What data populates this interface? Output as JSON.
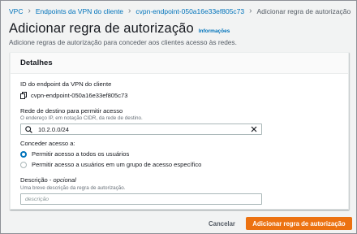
{
  "breadcrumb": {
    "items": [
      "VPC",
      "Endpoints da VPN do cliente",
      "cvpn-endpoint-050a16e33ef805c73"
    ],
    "current": "Adicionar regra de autorização"
  },
  "header": {
    "title": "Adicionar regra de autorização",
    "info_link": "Informações",
    "description": "Adicione regras de autorização para conceder aos clientes acesso às redes."
  },
  "panel": {
    "title": "Detalhes",
    "endpoint_id_label": "ID do endpoint da VPN do cliente",
    "endpoint_id_value": "cvpn-endpoint-050a16e33ef805c73",
    "dest_network_label": "Rede de destino para permitir acesso",
    "dest_network_hint": "O endereço IP, em notação CIDR, da rede de destino.",
    "dest_network_value": "10.2.0.0/24",
    "grant_access_label": "Conceder acesso a:",
    "radio_options": [
      {
        "label": "Permitir acesso a todos os usuários",
        "checked": true
      },
      {
        "label": "Permitir acesso a usuários em um grupo de acesso específico",
        "checked": false
      }
    ],
    "description_label": "Descrição",
    "description_optional": "opcional",
    "description_hint": "Uma breve descrição da regra de autorização.",
    "description_placeholder": "descrição"
  },
  "footer": {
    "cancel_label": "Cancelar",
    "submit_label": "Adicionar regra de autorização"
  },
  "colors": {
    "link": "#0073bb",
    "primary": "#ec7211",
    "radio_checked": "#0073bb"
  }
}
